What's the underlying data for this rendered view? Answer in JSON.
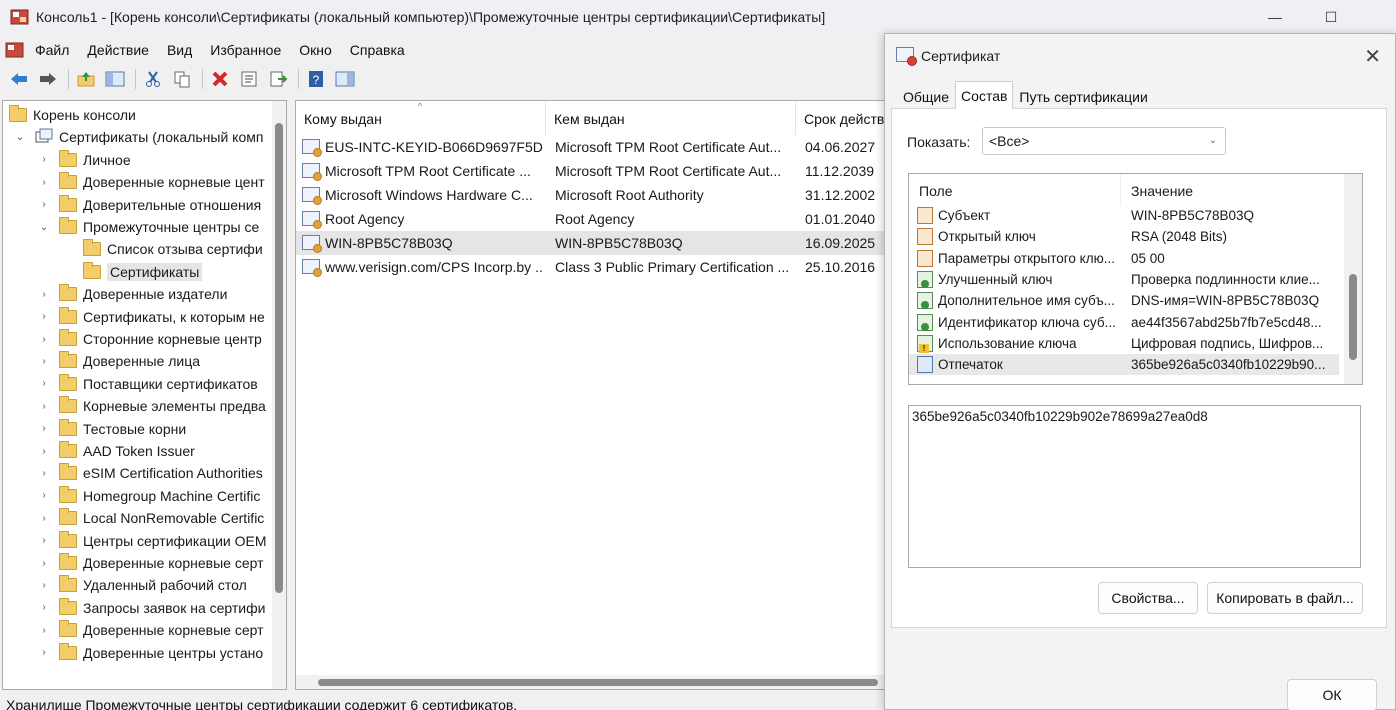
{
  "window": {
    "title": "Консоль1 - [Корень консоли\\Сертификаты (локальный компьютер)\\Промежуточные центры сертификации\\Сертификаты]",
    "minimize": "—",
    "maximize": "☐"
  },
  "menu": [
    "Файл",
    "Действие",
    "Вид",
    "Избранное",
    "Окно",
    "Справка"
  ],
  "tree": {
    "root": "Корень консоли",
    "items": [
      {
        "label": "Сертификаты (локальный комп",
        "level": 1,
        "chev": "⌄"
      },
      {
        "label": "Личное",
        "level": 2,
        "chev": "›"
      },
      {
        "label": "Доверенные корневые цент",
        "level": 2,
        "chev": "›"
      },
      {
        "label": "Доверительные отношения",
        "level": 2,
        "chev": "›"
      },
      {
        "label": "Промежуточные центры се",
        "level": 2,
        "chev": "⌄"
      },
      {
        "label": "Список отзыва сертифи",
        "level": 3,
        "chev": ""
      },
      {
        "label": "Сертификаты",
        "level": 3,
        "chev": "",
        "selected": true
      },
      {
        "label": "Доверенные издатели",
        "level": 2,
        "chev": "›"
      },
      {
        "label": "Сертификаты, к которым не",
        "level": 2,
        "chev": "›"
      },
      {
        "label": "Сторонние корневые центр",
        "level": 2,
        "chev": "›"
      },
      {
        "label": "Доверенные лица",
        "level": 2,
        "chev": "›"
      },
      {
        "label": "Поставщики сертификатов",
        "level": 2,
        "chev": "›"
      },
      {
        "label": "Корневые элементы предва",
        "level": 2,
        "chev": "›"
      },
      {
        "label": "Тестовые корни",
        "level": 2,
        "chev": "›"
      },
      {
        "label": "AAD Token Issuer",
        "level": 2,
        "chev": "›"
      },
      {
        "label": "eSIM Certification Authorities",
        "level": 2,
        "chev": "›"
      },
      {
        "label": "Homegroup Machine Certific",
        "level": 2,
        "chev": "›"
      },
      {
        "label": "Local NonRemovable Certific",
        "level": 2,
        "chev": "›"
      },
      {
        "label": "Центры сертификации OEM",
        "level": 2,
        "chev": "›"
      },
      {
        "label": "Доверенные корневые серт",
        "level": 2,
        "chev": "›"
      },
      {
        "label": "Удаленный рабочий стол",
        "level": 2,
        "chev": "›"
      },
      {
        "label": "Запросы заявок на сертифи",
        "level": 2,
        "chev": "›"
      },
      {
        "label": "Доверенные корневые серт",
        "level": 2,
        "chev": "›"
      },
      {
        "label": "Доверенные центры устано",
        "level": 2,
        "chev": "›"
      }
    ]
  },
  "list": {
    "columns": [
      "Кому выдан",
      "Кем выдан",
      "Срок действ"
    ],
    "rows": [
      {
        "to": "EUS-INTC-KEYID-B066D9697F5D...",
        "by": "Microsoft TPM Root Certificate Aut...",
        "exp": "04.06.2027"
      },
      {
        "to": "Microsoft TPM Root Certificate ...",
        "by": "Microsoft TPM Root Certificate Aut...",
        "exp": "11.12.2039"
      },
      {
        "to": "Microsoft Windows Hardware C...",
        "by": "Microsoft Root Authority",
        "exp": "31.12.2002"
      },
      {
        "to": "Root Agency",
        "by": "Root Agency",
        "exp": "01.01.2040"
      },
      {
        "to": "WIN-8PB5C78B03Q",
        "by": "WIN-8PB5C78B03Q",
        "exp": "16.09.2025",
        "selected": true
      },
      {
        "to": "www.verisign.com/CPS Incorp.by ...",
        "by": "Class 3 Public Primary Certification ...",
        "exp": "25.10.2016"
      }
    ]
  },
  "status": "Хранилище Промежуточные центры сертификации содержит 6 сертификатов.",
  "dialog": {
    "title": "Сертификат",
    "close": "✕",
    "tabs": [
      "Общие",
      "Состав",
      "Путь сертификации"
    ],
    "active_tab": 1,
    "show_label": "Показать:",
    "show_value": "<Все>",
    "fields_header": {
      "field": "Поле",
      "value": "Значение"
    },
    "fields": [
      {
        "name": "Субъект",
        "value": "WIN-8PB5C78B03Q",
        "icon": "doc"
      },
      {
        "name": "Открытый ключ",
        "value": "RSA (2048 Bits)",
        "icon": "doc"
      },
      {
        "name": "Параметры открытого клю...",
        "value": "05 00",
        "icon": "doc"
      },
      {
        "name": "Улучшенный ключ",
        "value": "Проверка подлинности клие...",
        "icon": "green"
      },
      {
        "name": "Дополнительное имя субъ...",
        "value": "DNS-имя=WIN-8PB5C78B03Q",
        "icon": "green"
      },
      {
        "name": "Идентификатор ключа суб...",
        "value": "ae44f3567abd25b7fb7e5cd48...",
        "icon": "green"
      },
      {
        "name": "Использование ключа",
        "value": "Цифровая подпись, Шифров...",
        "icon": "warn"
      },
      {
        "name": "Отпечаток",
        "value": "365be926a5c0340fb10229b90...",
        "icon": "blue",
        "selected": true
      }
    ],
    "value_text": "365be926a5c0340fb10229b902e78699a27ea0d8",
    "btn_properties": "Свойства...",
    "btn_copy": "Копировать в файл...",
    "btn_ok": "ОК"
  }
}
